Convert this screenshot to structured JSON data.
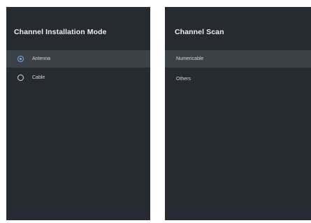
{
  "left_panel": {
    "title": "Channel Installation Mode",
    "options": [
      {
        "label": "Antenna",
        "selected": true
      },
      {
        "label": "Cable",
        "selected": false
      }
    ]
  },
  "right_panel": {
    "title": "Channel Scan",
    "items": [
      {
        "label": "Numericable",
        "highlighted": true
      },
      {
        "label": "Others",
        "highlighted": false
      }
    ]
  },
  "colors": {
    "panel_background": "#252b30",
    "highlight_row": "#3a4147",
    "radio_accent": "#7bb1e8"
  }
}
